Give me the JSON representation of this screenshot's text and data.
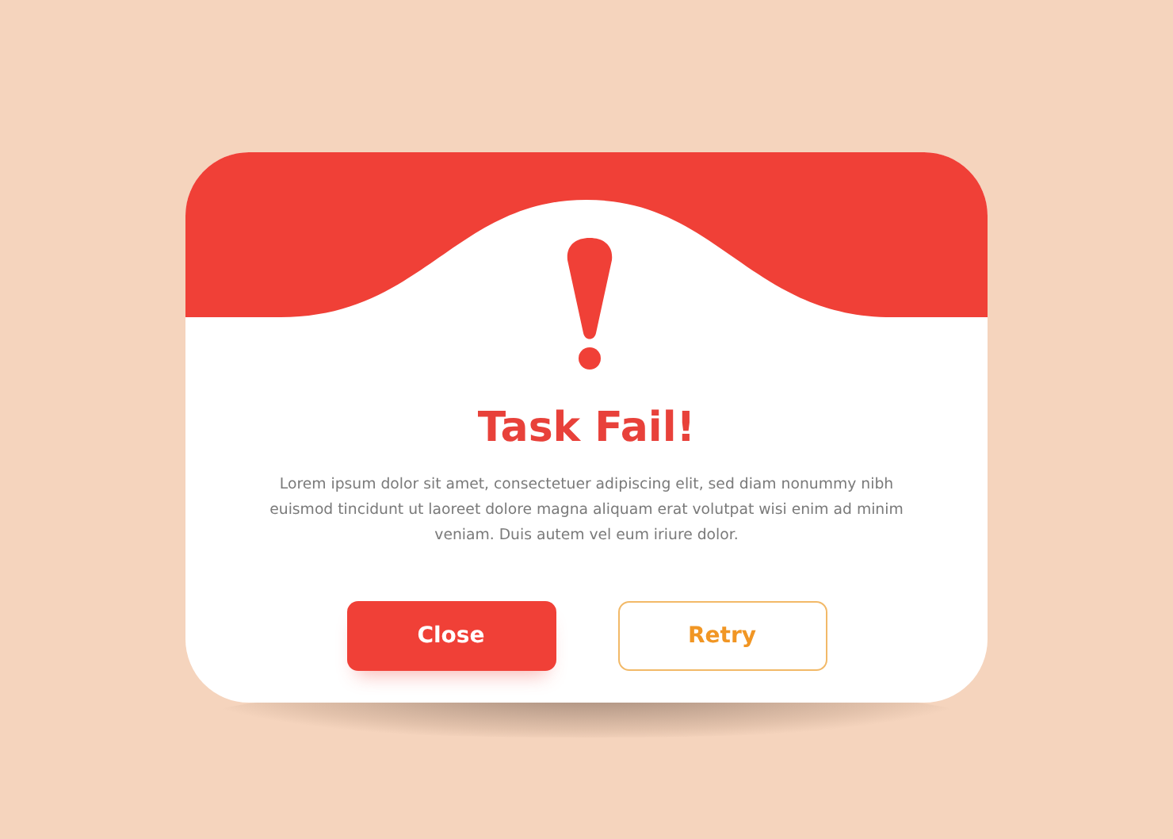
{
  "dialog": {
    "title": "Task Fail!",
    "message": "Lorem ipsum dolor sit amet, consectetuer adipiscing elit, sed diam nonummy nibh euismod tincidunt ut laoreet dolore magna aliquam erat volutpat wisi enim ad minim veniam. Duis autem vel eum iriure dolor.",
    "buttons": [
      {
        "label": "Close",
        "kind": "primary"
      },
      {
        "label": "Retry",
        "kind": "outline"
      }
    ]
  }
}
